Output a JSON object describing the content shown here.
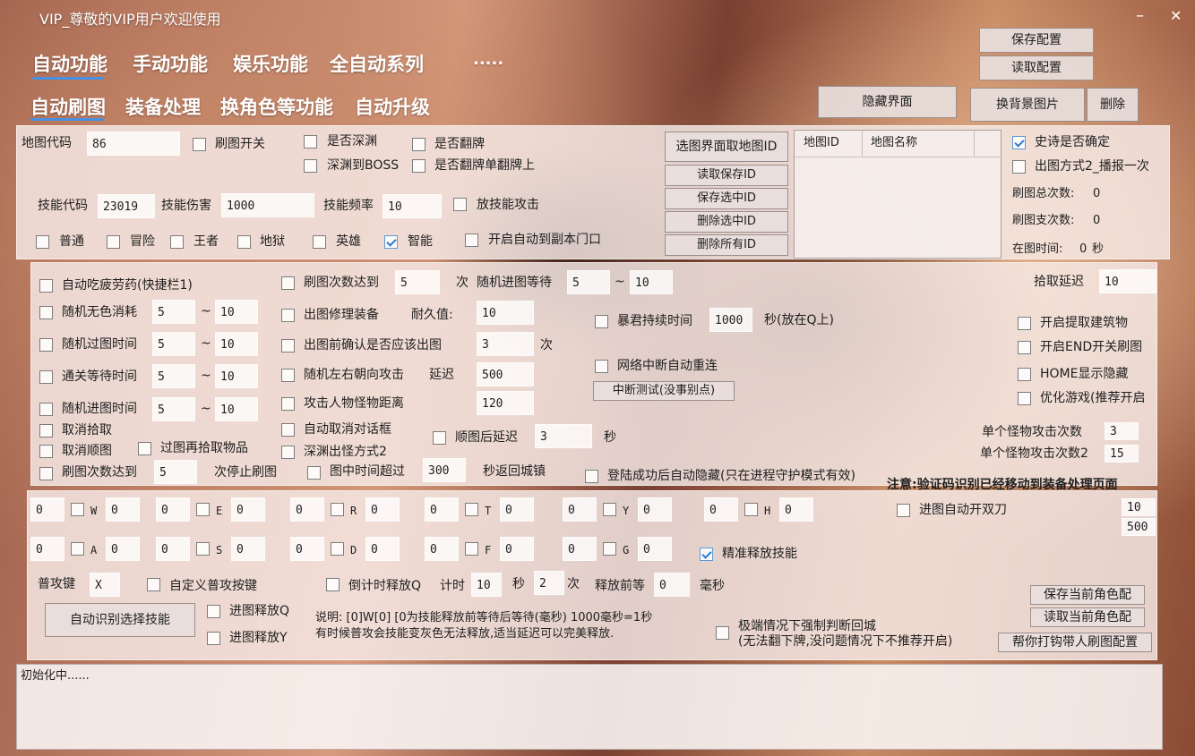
{
  "window": {
    "title": "VIP_尊敬的VIP用户欢迎使用",
    "min": "–",
    "close": "✕"
  },
  "nav_top": [
    "自动功能",
    "手动功能",
    "娱乐功能",
    "全自动系列",
    "....."
  ],
  "nav_sub": [
    "自动刷图",
    "装备处理",
    "换角色等功能",
    "自动升级"
  ],
  "top_buttons": {
    "save_config": "保存配置",
    "load_config": "读取配置",
    "hide_ui": "隐藏界面",
    "change_bg": "换背景图片",
    "delete": "删除"
  },
  "s1": {
    "map_code_label": "地图代码",
    "map_code": "86",
    "brush_switch": "刷图开关",
    "is_abyss": "是否深渊",
    "abyss_boss": "深渊到BOSS",
    "is_flip": "是否翻牌",
    "flip_single": "是否翻牌单翻牌上",
    "skill_code_label": "技能代码",
    "skill_code": "23019",
    "skill_dmg_label": "技能伤害",
    "skill_dmg": "1000",
    "skill_freq_label": "技能频率",
    "skill_freq": "10",
    "skill_attack": "放技能攻击",
    "diff": [
      "普通",
      "冒险",
      "王者",
      "地狱",
      "英雄",
      "智能"
    ],
    "auto_door": "开启自动到副本门口"
  },
  "mapid": {
    "pick_btn": "选图界面取地图ID",
    "read_btn": "读取保存ID",
    "save_btn": "保存选中ID",
    "del_btn": "删除选中ID",
    "del_all_btn": "删除所有ID",
    "col_id": "地图ID",
    "col_name": "地图名称"
  },
  "right1": {
    "epic_confirm": "史诗是否确定",
    "out_mode2": "出图方式2_播报一次",
    "total_label": "刷图总次数:",
    "total": "0",
    "branch_label": "刷图支次数:",
    "branch": "0",
    "time_label": "在图时间:",
    "time": "0",
    "time_unit": "秒"
  },
  "s2": {
    "auto_potion": "自动吃疲劳药(快捷栏1)",
    "rand_nocolor": "随机无色消耗",
    "rn_a": "5",
    "rn_b": "10",
    "rand_pass": "随机过图时间",
    "rp_a": "5",
    "rp_b": "10",
    "clear_wait": "通关等待时间",
    "cw_a": "5",
    "cw_b": "10",
    "rand_enter": "随机进图时间",
    "re_a": "5",
    "re_b": "10",
    "tilde": "~",
    "cancel_pick": "取消拾取",
    "cancel_seq": "取消顺图",
    "pick_after": "过图再拾取物品",
    "stop_after": "刷图次数达到",
    "stop_n": "5",
    "stop_suffix": "次停止刷图",
    "count_reach": "刷图次数达到",
    "count_n": "5",
    "count_unit": "次",
    "rand_enter_wait": "随机进图等待",
    "rew_a": "5",
    "rew_b": "10",
    "repair": "出图修理装备",
    "durability_label": "耐久值:",
    "durability": "10",
    "confirm_out": "出图前确认是否应该出图",
    "confirm_n": "3",
    "confirm_unit": "次",
    "rand_dir": "随机左右朝向攻击",
    "delay_label": "延迟",
    "delay": "500",
    "attack_dist": "攻击人物怪物距离",
    "dist": "120",
    "auto_dialog": "自动取消对话框",
    "abyss_mode2": "深渊出怪方式2",
    "in_map_over": "图中时间超过",
    "over_s": "300",
    "over_suffix": "秒返回城镇",
    "seq_delay": "顺图后延迟",
    "seq_delay_v": "3",
    "sec": "秒",
    "tyrant": "暴君持续时间",
    "tyrant_v": "1000",
    "tyrant_suffix": "秒(放在Q上)",
    "net_retry": "网络中断自动重连",
    "net_test": "中断测试(没事别点)",
    "auto_hide": "登陆成功后自动隐藏(只在进程守护模式有效)",
    "pick_delay_label": "拾取延迟",
    "pick_delay": "10",
    "build": "开启提取建筑物",
    "end_switch": "开启END开关刷图",
    "home_hide": "HOME显示隐藏",
    "optimize": "优化游戏(推荐开启",
    "mon_atk": "单个怪物攻击次数",
    "mon_atk_v": "3",
    "mon_atk2": "单个怪物攻击次数2",
    "mon_atk2_v": "15",
    "notice": "注意:验证码识别已经移动到装备处理页面"
  },
  "s3": {
    "row1": [
      {
        "pre": "0",
        "key": "W",
        "val": "0"
      },
      {
        "pre": "0",
        "key": "E",
        "val": "0"
      },
      {
        "pre": "0",
        "key": "R",
        "val": "0"
      },
      {
        "pre": "0",
        "key": "T",
        "val": "0"
      },
      {
        "pre": "0",
        "key": "Y",
        "val": "0"
      },
      {
        "pre": "0",
        "key": "H",
        "val": "0"
      }
    ],
    "row2": [
      {
        "pre": "0",
        "key": "A",
        "val": "0"
      },
      {
        "pre": "0",
        "key": "S",
        "val": "0"
      },
      {
        "pre": "0",
        "key": "D",
        "val": "0"
      },
      {
        "pre": "0",
        "key": "F",
        "val": "0"
      },
      {
        "pre": "0",
        "key": "G",
        "val": "0"
      }
    ],
    "dual_blade": "进图自动开双刀",
    "v10": "10",
    "v500": "500",
    "precise": "精准释放技能",
    "normal_key_label": "普攻键",
    "normal_key": "X",
    "custom_key": "自定义普攻按键",
    "countdown_q": "倒计时释放Q",
    "timer_label": "计时",
    "timer": "10",
    "sec": "秒",
    "times": "2",
    "times_unit": "次",
    "pre_wait_label": "释放前等",
    "pre_wait": "0",
    "ms": "毫秒",
    "auto_skill_btn": "自动识别选择技能",
    "enter_q": "进图释放Q",
    "enter_y": "进图释放Y",
    "desc1": "说明: [0]W[0]  [0为技能释放前等待后等待(毫秒)   1000毫秒=1秒",
    "desc2": "有时候普攻会技能变灰色无法释放,适当延迟可以完美释放.",
    "force_return": "极端情况下强制判断回城",
    "force_return_sub": "(无法翻下牌,没问题情况下不推荐开启)",
    "save_role": "保存当前角色配",
    "load_role": "读取当前角色配",
    "help_btn": "帮你打钩带人刷图配置"
  },
  "log": "初始化中......"
}
